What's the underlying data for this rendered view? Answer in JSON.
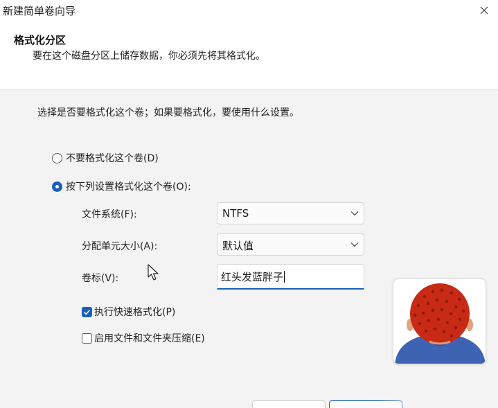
{
  "window": {
    "title": "新建简单卷向导"
  },
  "header": {
    "title": "格式化分区",
    "subtitle": "要在这个磁盘分区上储存数据，你必须先将其格式化。"
  },
  "instruction": "选择是否要格式化这个卷；如果要格式化，要使用什么设置。",
  "options": {
    "no_format": {
      "label": "不要格式化这个卷(D)",
      "selected": false
    },
    "format": {
      "label": "按下列设置格式化这个卷(O):",
      "selected": true
    }
  },
  "fields": {
    "filesystem": {
      "label": "文件系统(F):",
      "value": "NTFS"
    },
    "allocation": {
      "label": "分配单元大小(A):",
      "value": "默认值"
    },
    "volume_label": {
      "label": "卷标(V):",
      "value": "红头发蓝胖子"
    }
  },
  "checkboxes": {
    "quick_format": {
      "label": "执行快速格式化(P)",
      "checked": true
    },
    "compression": {
      "label": "启用文件和文件夹压缩(E)",
      "checked": false
    }
  },
  "icons": {
    "close": "close-icon",
    "chevron": "chevron-down-icon",
    "cursor": "mouse-pointer-icon",
    "avatar": "red-hair-avatar-icon"
  },
  "colors": {
    "accent": "#1b5fb8",
    "background": "#f3f3f3",
    "header_bg": "#ffffff"
  }
}
